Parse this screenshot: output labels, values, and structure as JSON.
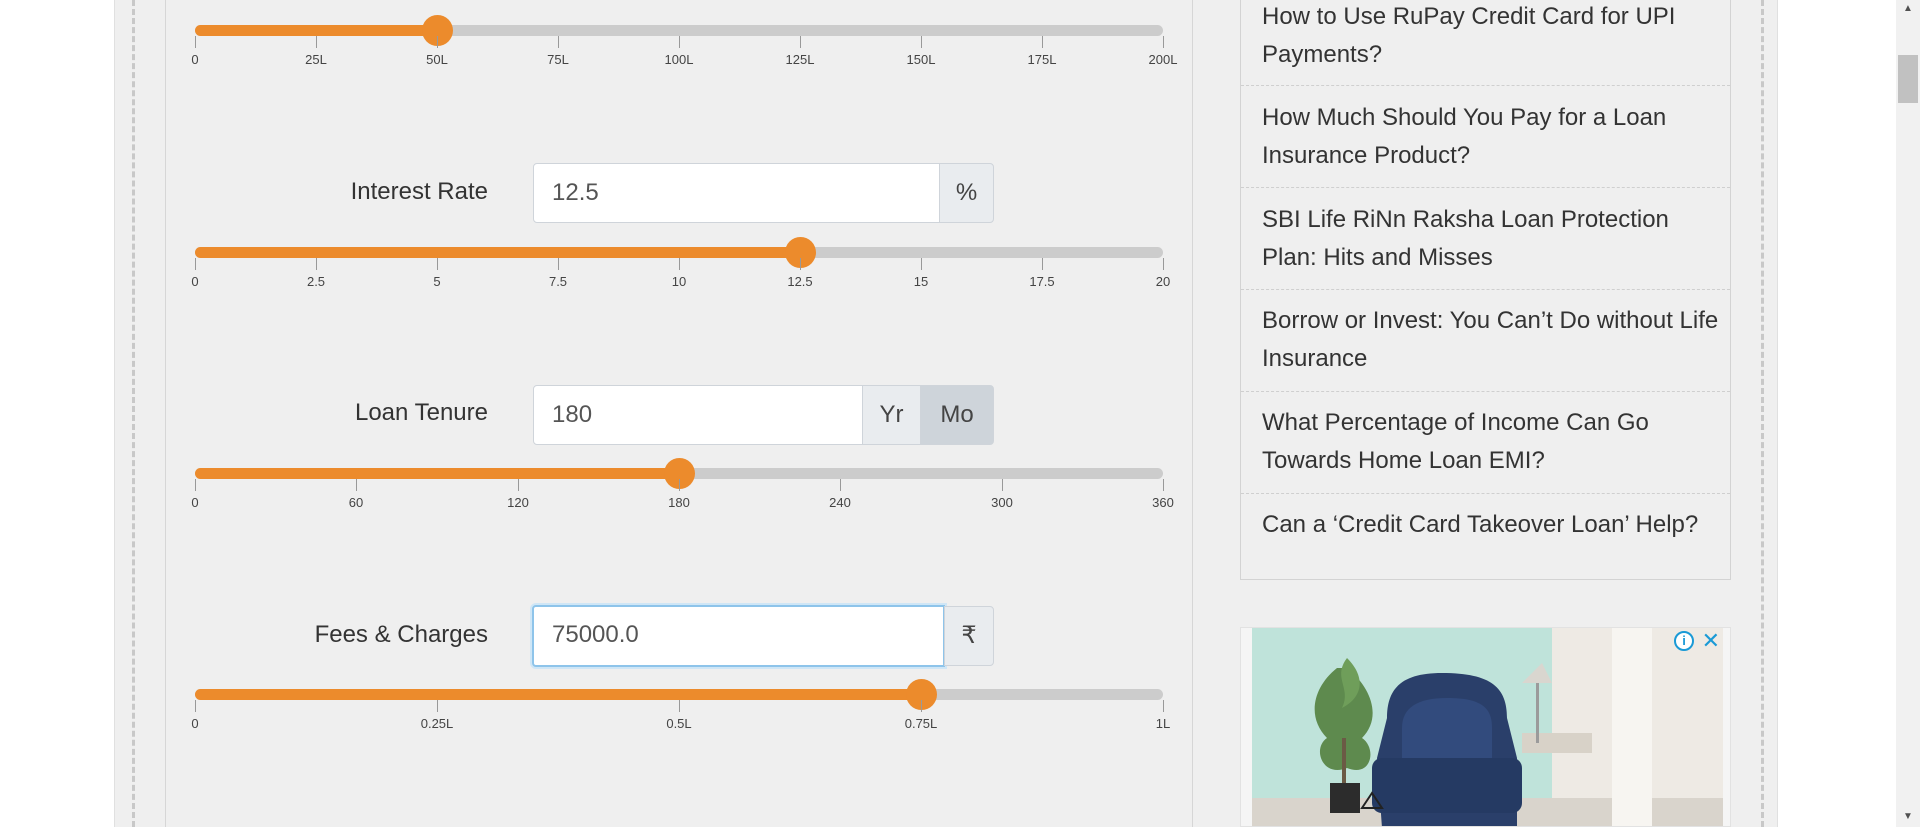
{
  "calculator": {
    "loan_amount": {
      "slider_value_fraction": 0.25,
      "ticks": [
        "0",
        "25L",
        "50L",
        "75L",
        "100L",
        "125L",
        "150L",
        "175L",
        "200L"
      ]
    },
    "interest_rate": {
      "label": "Interest Rate",
      "value": "12.5",
      "unit": "%",
      "slider_value_fraction": 0.625,
      "ticks": [
        "0",
        "2.5",
        "5",
        "7.5",
        "10",
        "12.5",
        "15",
        "17.5",
        "20"
      ]
    },
    "loan_tenure": {
      "label": "Loan Tenure",
      "value": "180",
      "unit_options": [
        "Yr",
        "Mo"
      ],
      "selected_unit": "Mo",
      "slider_value_fraction": 0.5,
      "ticks": [
        "0",
        "60",
        "120",
        "180",
        "240",
        "300",
        "360"
      ]
    },
    "fees_charges": {
      "label": "Fees & Charges",
      "value": "75000.0",
      "unit": "₹",
      "slider_value_fraction": 0.75,
      "ticks": [
        "0",
        "0.25L",
        "0.5L",
        "0.75L",
        "1L"
      ]
    }
  },
  "sidebar": {
    "articles": [
      "How to Use RuPay Credit Card for UPI Payments?",
      "How Much Should You Pay for a Loan Insurance Product?",
      "SBI Life RiNn Raksha Loan Protection Plan: Hits and Misses",
      "Borrow or Invest: You Can’t Do without Life Insurance",
      "What Percentage of Income Can Go Towards Home Loan EMI?",
      "Can a ‘Credit Card Takeover Loan’ Help?"
    ]
  },
  "ad": {
    "info_icon": "info-icon",
    "close_icon": "close-icon"
  },
  "colors": {
    "accent": "#ec8b2c",
    "track": "#cccccc",
    "focus": "#8ec4ea",
    "ad_icon": "#1a9ad6"
  }
}
